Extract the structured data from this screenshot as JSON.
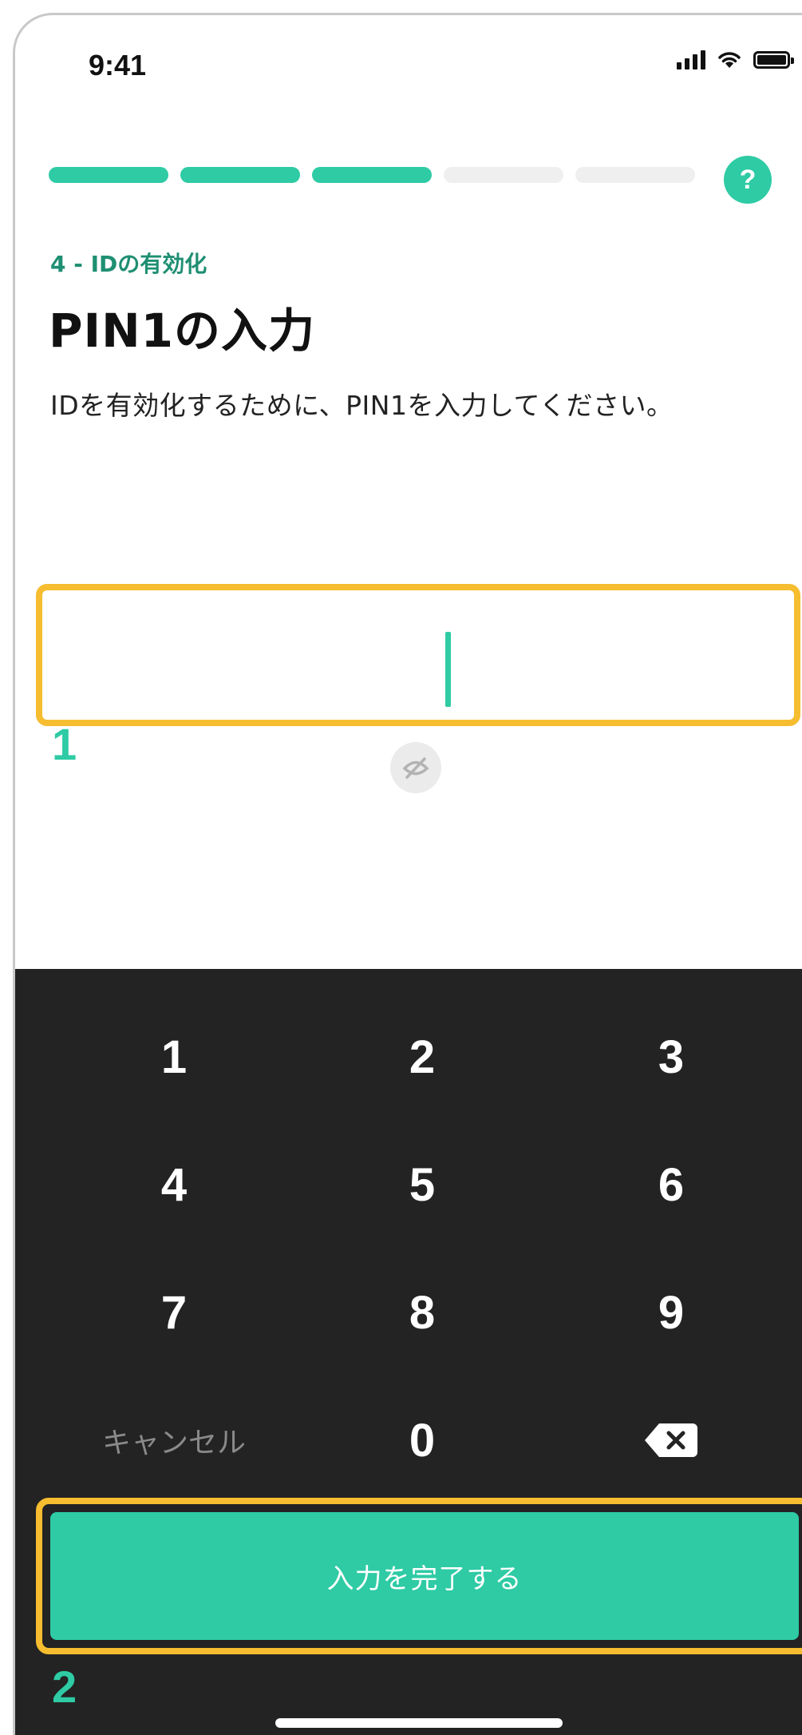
{
  "status_bar": {
    "time": "9:41"
  },
  "progress": {
    "total_steps": 5,
    "completed_steps": 3
  },
  "help_button": {
    "label": "?"
  },
  "header": {
    "step_label": "4 - IDの有効化",
    "title": "PIN1の入力",
    "description": "IDを有効化するために、PIN1を入力してください。"
  },
  "pin_input": {
    "value": ""
  },
  "callouts": {
    "first": "1",
    "second": "2"
  },
  "keypad": {
    "keys": [
      "1",
      "2",
      "3",
      "4",
      "5",
      "6",
      "7",
      "8",
      "9"
    ],
    "cancel_label": "キャンセル",
    "zero": "0"
  },
  "complete_button": {
    "label": "入力を完了する"
  },
  "colors": {
    "accent": "#2ecba5",
    "highlight": "#f5bd2f",
    "keypad_bg": "#232323"
  },
  "icons": {
    "help": "help-icon",
    "visibility": "eye-off-icon",
    "delete": "backspace-icon"
  }
}
